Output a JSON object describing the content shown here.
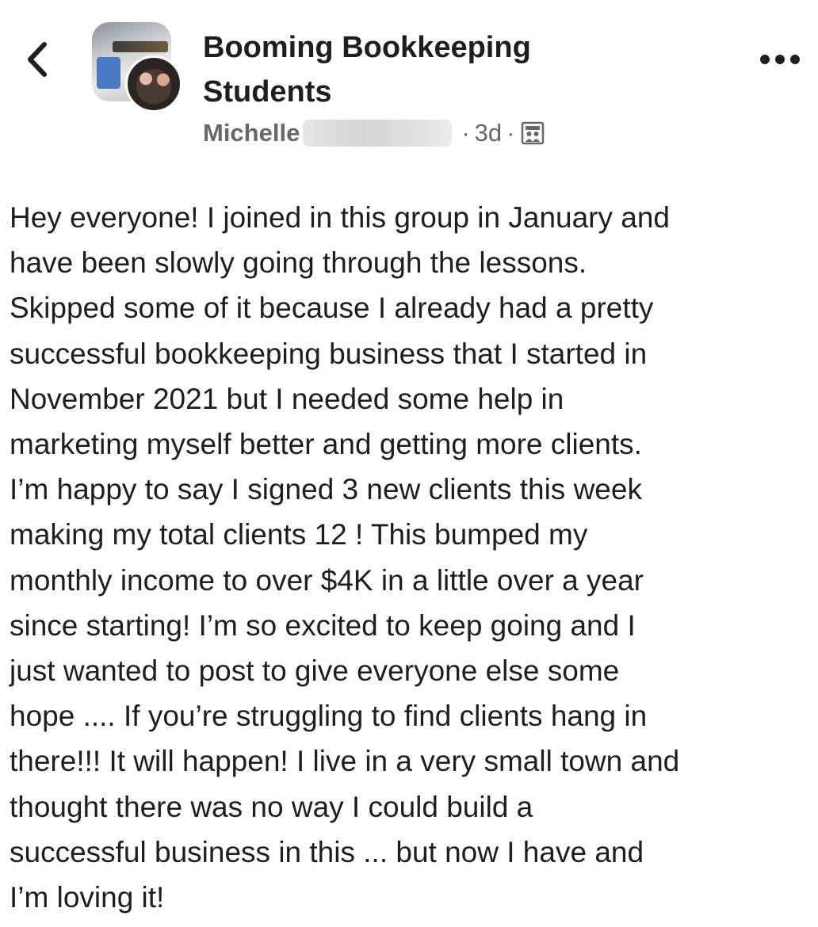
{
  "header": {
    "back_icon": "chevron-left-icon",
    "group_name_line1": "Booming Bookkeeping",
    "group_name_line2": "Students",
    "author_first_name": "Michelle",
    "separator1": "·",
    "time_ago": "3d",
    "separator2": "·",
    "audience_icon": "group-members-icon",
    "more_icon": "more-dots-icon"
  },
  "post": {
    "lines": [
      "Hey everyone! I joined in this group in January and",
      "have been slowly going through the lessons.",
      "Skipped some of it because I already had a pretty",
      "successful bookkeeping business that I started in",
      "November 2021 but I needed some help in",
      "marketing myself better and getting more clients.",
      "I’m happy to say I signed 3 new clients this week",
      "making my total clients 12 ! This bumped my",
      "monthly income to over $4K in a little over a year",
      "since starting! I’m so excited to keep going and I",
      "just wanted to post to give everyone else some",
      "hope .... If you’re struggling to find clients hang in",
      "there!!! It will happen! I live in a very small town and",
      "thought there was no way I could build a",
      "successful business in this ... but now I have and",
      "I’m loving it!"
    ]
  },
  "colors": {
    "text_primary": "#1c1e21",
    "text_secondary": "#65676b",
    "background": "#ffffff"
  }
}
